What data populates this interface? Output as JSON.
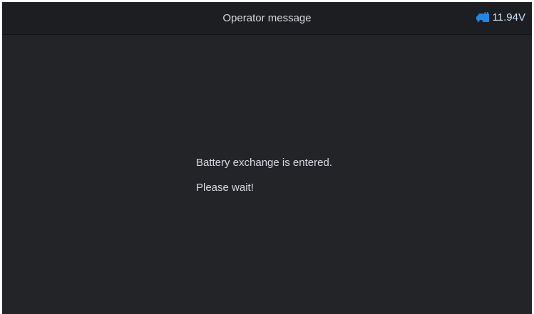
{
  "header": {
    "title": "Operator message",
    "voltage": "11.94V",
    "voltage_icon": "car-battery-icon",
    "accent": "#1e88e5"
  },
  "main": {
    "lines": [
      "Battery exchange is entered.",
      "Please wait!"
    ]
  }
}
